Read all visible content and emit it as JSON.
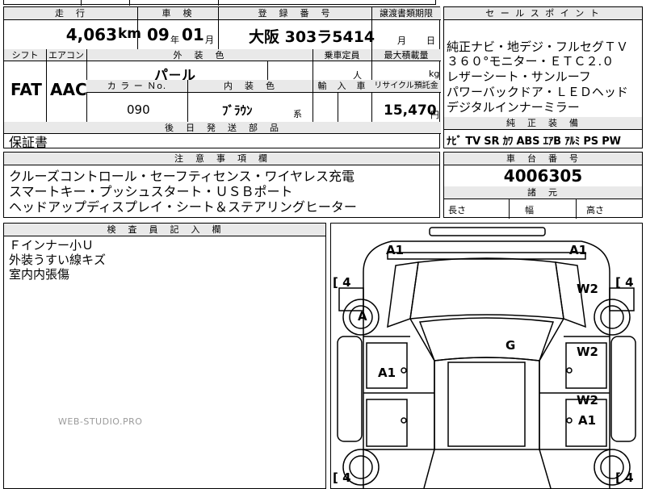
{
  "top_strip": [
    ""
  ],
  "row1": {
    "headers": {
      "mileage": "走　行",
      "inspection": "車　検",
      "reg_no": "登　録　番　号",
      "transfer_deadline": "譲渡書類期限"
    },
    "mileage": "4,063",
    "mileage_unit": "km",
    "inspection_year": "09",
    "year_unit": "年",
    "inspection_month": "01",
    "month_unit": "月",
    "reg_no": "大阪 303ラ5414",
    "deadline_month_unit": "月",
    "deadline_day_unit": "日"
  },
  "row2": {
    "headers": {
      "shift": "シフト",
      "ac": "エアコン",
      "ext_color": "外　装　色",
      "capacity": "乗車定員",
      "max_load": "最大積載量"
    },
    "shift": "FAT",
    "ac": "AAC",
    "ext_color": "パ－ル",
    "capacity_unit": "人",
    "load_unit": "kg"
  },
  "row3": {
    "headers": {
      "color_no": "カ ラ ー Ｎo.",
      "interior": "内　装　色",
      "import": "輸　入　車",
      "recycle": "リサイクル預託金"
    },
    "color_no": "090",
    "interior": "ﾌﾞﾗｳﾝ",
    "interior_suffix": "系",
    "recycle_amount": "15,470",
    "recycle_unit": "円"
  },
  "later_parts": {
    "header": "後　日　発　送　部　品",
    "value": "保証書"
  },
  "sales_points": {
    "header": "セ ー ル ス ポ イ ン ト",
    "lines": [
      "純正ナビ・地デジ・フルセグＴＶ",
      "３６０°モニター・ＥＴＣ２.０",
      "レザーシート・サンルーフ",
      "パワーバックドア・ＬＥＤヘッド",
      "デジタルインナーミラー"
    ]
  },
  "equipment": {
    "header": "純　正　装　備",
    "value": "ﾅﾋﾞ TV SR ｶﾜ ABS ｴｱB ｱﾙﾐ PS PW"
  },
  "notes": {
    "header": "注　意　事　項　欄",
    "lines": [
      "クルーズコントロール・セーフティセンス・ワイヤレス充電",
      "スマートキー・プッシュスタート・ＵＳＢポート",
      "ヘッドアップディスプレイ・シート＆ステアリングヒーター"
    ]
  },
  "chassis": {
    "header": "車　台　番　号",
    "value": "4006305"
  },
  "dimensions": {
    "header": "諸　元",
    "length": "長さ",
    "width": "幅",
    "height": "高さ"
  },
  "inspector": {
    "header": "検　査　員　記　入　欄",
    "lines": [
      "Ｆインナー小Ｕ",
      "外装うすい線キズ",
      "室内内張傷"
    ]
  },
  "watermark": "WEB-STUDIO.PRO",
  "diagram": {
    "labels": {
      "a1_front_left": "A1",
      "a1_front_right": "A1",
      "a_left_wheel": "A",
      "w2_right_upper": "W2",
      "g_windshield": "G",
      "w2_right_door1": "W2",
      "a1_left_door": "A1",
      "w2_right_door2": "W2",
      "a1_right_lower": "A1"
    },
    "tire_marks": {
      "front_left": "4",
      "front_right": "4",
      "rear_left": "4",
      "rear_right": "4"
    }
  }
}
